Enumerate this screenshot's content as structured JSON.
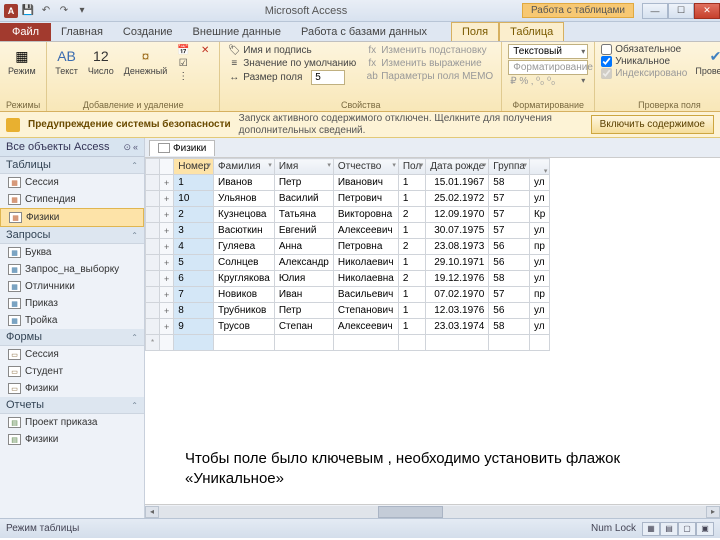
{
  "titlebar": {
    "app_title": "Microsoft Access",
    "tool_context": "Работа с таблицами"
  },
  "tabs": {
    "file": "Файл",
    "items": [
      "Главная",
      "Создание",
      "Внешние данные",
      "Работа с базами данных"
    ],
    "ctx": [
      "Поля",
      "Таблица"
    ]
  },
  "ribbon": {
    "g1": {
      "label": "Режимы",
      "btn": "Режим"
    },
    "g2": {
      "label": "Добавление и удаление",
      "text": "Текст",
      "number": "Число",
      "currency": "Денежный"
    },
    "g3": {
      "label": "Свойства",
      "name_caption": "Имя и подпись",
      "default_val": "Значение по умолчанию",
      "field_size_lbl": "Размер поля",
      "field_size_val": "5",
      "modify_lookup": "Изменить подстановку",
      "modify_expr": "Изменить выражение",
      "memo": "Параметры поля MEMO"
    },
    "g4": {
      "label": "Форматирование",
      "datatype": "Текстовый",
      "format_lbl": "Форматирование"
    },
    "g5": {
      "label": "Проверка поля",
      "required": "Обязательное",
      "unique": "Уникальное",
      "indexed": "Индексировано",
      "validation": "Проверка"
    }
  },
  "security": {
    "title": "Предупреждение системы безопасности",
    "msg": "Запуск активного содержимого отключен. Щелкните для получения дополнительных сведений.",
    "btn": "Включить содержимое"
  },
  "nav": {
    "header": "Все объекты Access",
    "cats": {
      "tables": {
        "label": "Таблицы",
        "items": [
          "Сессия",
          "Стипендия",
          "Физики"
        ]
      },
      "queries": {
        "label": "Запросы",
        "items": [
          "Буква",
          "Запрос_на_выборку",
          "Отличники",
          "Приказ",
          "Тройка"
        ]
      },
      "forms": {
        "label": "Формы",
        "items": [
          "Сессия",
          "Студент",
          "Физики"
        ]
      },
      "reports": {
        "label": "Отчеты",
        "items": [
          "Проект приказа",
          "Физики"
        ]
      }
    }
  },
  "datasheet": {
    "tab_name": "Физики",
    "columns": [
      "Номер",
      "Фамилия",
      "Имя",
      "Отчество",
      "Пол",
      "Дата рожде",
      "Группа",
      ""
    ],
    "rows": [
      [
        "1",
        "Иванов",
        "Петр",
        "Иванович",
        "1",
        "15.01.1967",
        "58",
        "ул"
      ],
      [
        "10",
        "Ульянов",
        "Василий",
        "Петрович",
        "1",
        "25.02.1972",
        "57",
        "ул"
      ],
      [
        "2",
        "Кузнецова",
        "Татьяна",
        "Викторовна",
        "2",
        "12.09.1970",
        "57",
        "Кр"
      ],
      [
        "3",
        "Васюткин",
        "Евгений",
        "Алексеевич",
        "1",
        "30.07.1975",
        "57",
        "ул"
      ],
      [
        "4",
        "Гуляева",
        "Анна",
        "Петровна",
        "2",
        "23.08.1973",
        "56",
        "пр"
      ],
      [
        "5",
        "Солнцев",
        "Александр",
        "Николаевич",
        "1",
        "29.10.1971",
        "56",
        "ул"
      ],
      [
        "6",
        "Круглякова",
        "Юлия",
        "Николаевна",
        "2",
        "19.12.1976",
        "58",
        "ул"
      ],
      [
        "7",
        "Новиков",
        "Иван",
        "Васильевич",
        "1",
        "07.02.1970",
        "57",
        "пр"
      ],
      [
        "8",
        "Трубников",
        "Петр",
        "Степанович",
        "1",
        "12.03.1976",
        "56",
        "ул"
      ],
      [
        "9",
        "Трусов",
        "Степан",
        "Алексеевич",
        "1",
        "23.03.1974",
        "58",
        "ул"
      ]
    ]
  },
  "hint": "Чтобы поле было ключевым , необходимо установить флажок «Уникальное»",
  "statusbar": {
    "mode": "Режим таблицы",
    "numlock": "Num Lock"
  }
}
